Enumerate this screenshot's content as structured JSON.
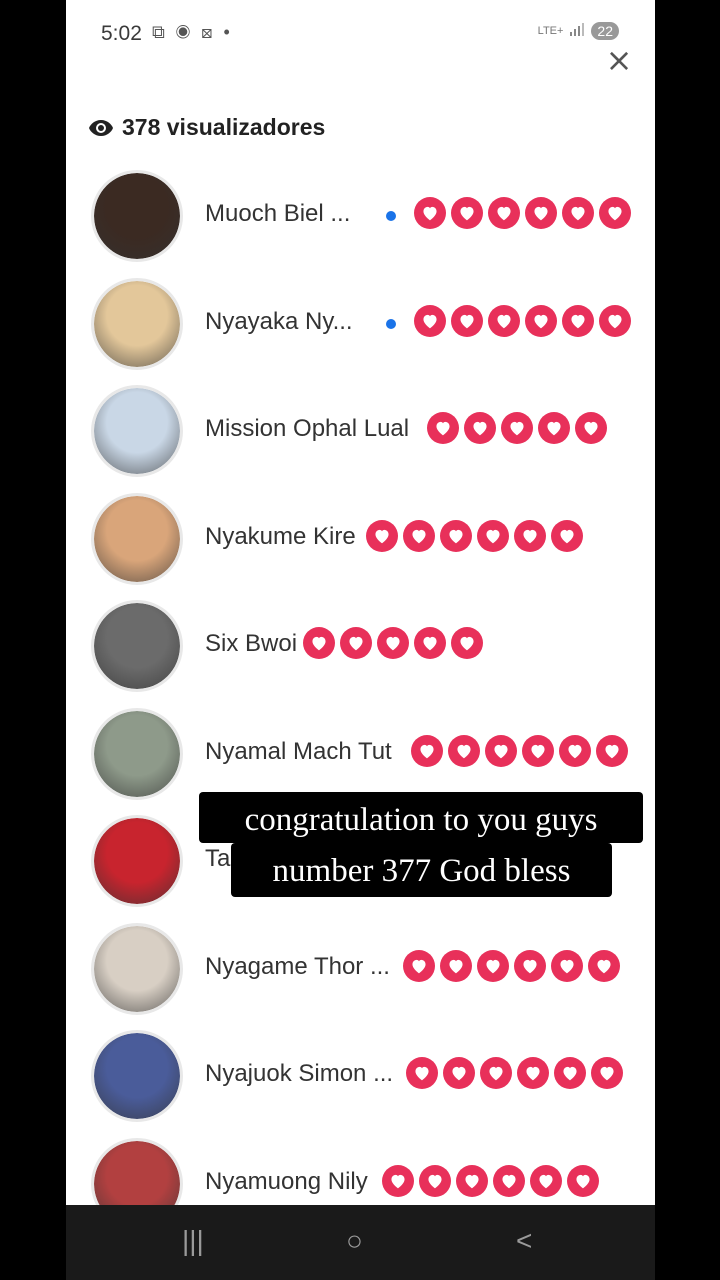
{
  "status_bar": {
    "time": "5:02",
    "left_icons": "⧉ ◉ ⊠ •",
    "network": "LTE+",
    "battery": "22"
  },
  "header": {
    "viewers_label": "378 visualizadores"
  },
  "viewers": [
    {
      "name": "Muoch Biel ...",
      "online": true,
      "hearts": 6,
      "avatar_color": "#3b2a22"
    },
    {
      "name": "Nyayaka Ny...",
      "online": true,
      "hearts": 6,
      "avatar_color": "#e3c79a"
    },
    {
      "name": "Mission Ophal Lual",
      "online": false,
      "hearts": 5,
      "avatar_color": "#c9d7e6"
    },
    {
      "name": "Nyakume Kire",
      "online": false,
      "hearts": 6,
      "avatar_color": "#d9a57a"
    },
    {
      "name": "Six Bwoi",
      "online": false,
      "hearts": 5,
      "avatar_color": "#6b6b6b"
    },
    {
      "name": "Nyamal Mach Tut",
      "online": false,
      "hearts": 6,
      "avatar_color": "#8e9a8a"
    },
    {
      "name": "Ta",
      "online": false,
      "hearts": 0,
      "avatar_color": "#c8242e"
    },
    {
      "name": "Nyagame Thor ...",
      "online": false,
      "hearts": 6,
      "avatar_color": "#d8cfc4"
    },
    {
      "name": "Nyajuok Simon ...",
      "online": false,
      "hearts": 6,
      "avatar_color": "#4a5c9a"
    },
    {
      "name": "Nyamuong Nily",
      "online": false,
      "hearts": 6,
      "avatar_color": "#b24040"
    }
  ],
  "caption": {
    "line1": "congratulation to you guys",
    "line2": "number 377 God bless"
  },
  "nav": {
    "recents": "|||",
    "home": "○",
    "back": "<"
  },
  "colors": {
    "heart": "#e8305a",
    "online": "#1a73e8"
  }
}
